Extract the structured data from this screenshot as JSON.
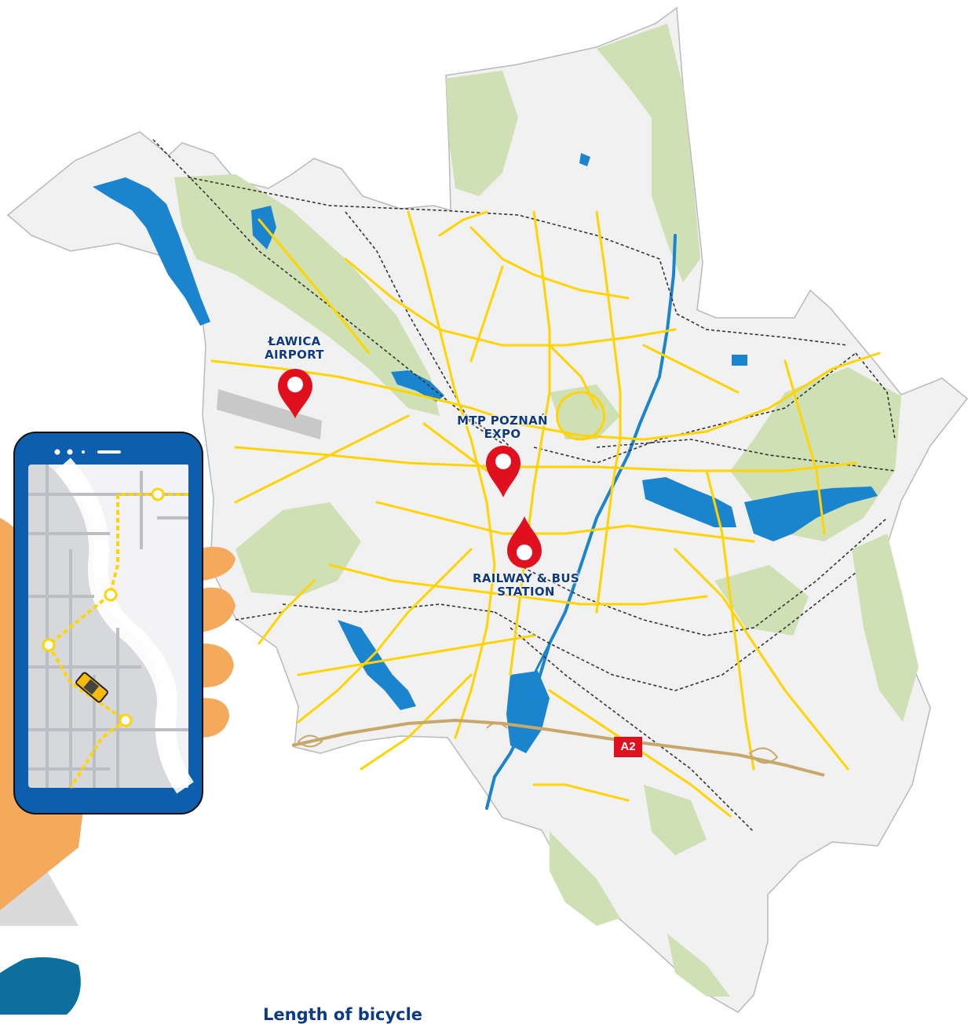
{
  "map": {
    "places": {
      "airport": {
        "line1": "ŁAWICA",
        "line2": "AIRPORT"
      },
      "expo": {
        "line1": "MTP POZNAŃ",
        "line2": "EXPO"
      },
      "station": {
        "line1": "RAILWAY & BUS",
        "line2": "STATION"
      }
    },
    "motorway_label": "A2",
    "colors": {
      "land": "#f1f1f1",
      "green": "#cfe0b5",
      "water": "#1a84cf",
      "roads": "#ffd400",
      "motorway": "#c8a86a",
      "pin": "#e0101e",
      "label": "#0d3a86",
      "a2_badge": "#e0101e"
    }
  },
  "heading_partial": "Length of bicycle",
  "illustration": {
    "phone_status_icons": [
      "dot-icon",
      "dot-icon",
      "dot-icon",
      "bar-icon"
    ],
    "icon": "taxi-car-icon"
  }
}
